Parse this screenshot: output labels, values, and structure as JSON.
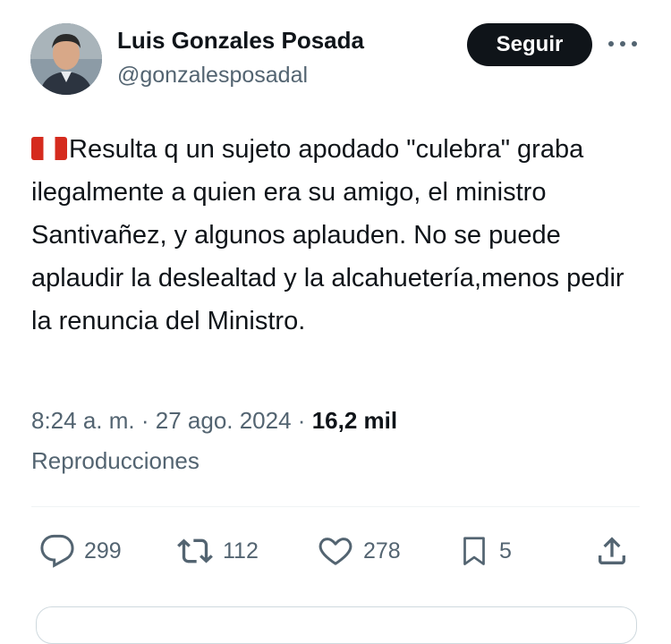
{
  "author": {
    "name": "Luis Gonzales Posada",
    "handle": "@gonzalesposadal"
  },
  "follow_label": "Seguir",
  "tweet": {
    "flag_icon": "peru-flag-icon",
    "text": "Resulta q un sujeto apodado \"culebra\" graba ilegalmente a quien era su amigo, el ministro Santivañez, y algunos aplauden. No se puede aplaudir la deslealtad y la alcahuetería,menos pedir la renuncia del Ministro."
  },
  "meta": {
    "time": "8:24 a. m.",
    "date": "27 ago. 2024",
    "views": "16,2 mil",
    "views_label": "Reproducciones"
  },
  "actions": {
    "replies": "299",
    "retweets": "112",
    "likes": "278",
    "bookmarks": "5"
  },
  "colors": {
    "text": "#0f1419",
    "secondary": "#536471",
    "divider": "#eff3f4",
    "button_bg": "#0f1419",
    "flag_red": "#d52b1e"
  }
}
